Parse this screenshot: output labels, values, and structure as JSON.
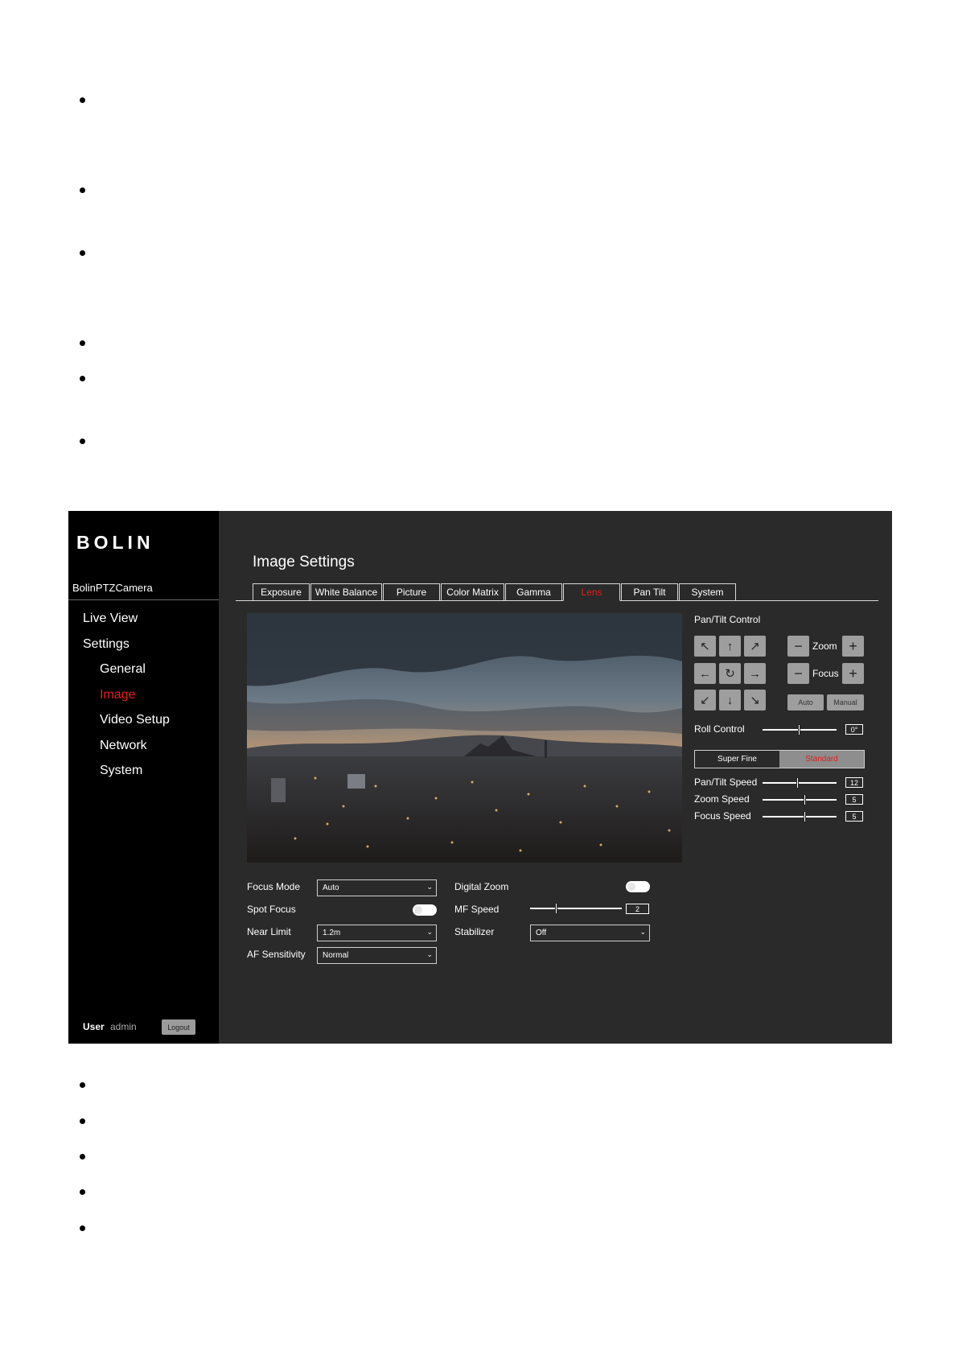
{
  "sidebar": {
    "logo": "BOLIN",
    "device_name": "BolinPTZCamera",
    "nav": [
      {
        "label": "Live View",
        "active": false
      },
      {
        "label": "Settings",
        "active": false
      },
      {
        "label": "General",
        "active": false
      },
      {
        "label": "Image",
        "active": true
      },
      {
        "label": "Video Setup",
        "active": false
      },
      {
        "label": "Network",
        "active": false
      },
      {
        "label": "System",
        "active": false
      }
    ],
    "user_label": "User",
    "user_name": "admin",
    "logout_label": "Logout"
  },
  "page_title": "Image Settings",
  "tabs": [
    {
      "label": "Exposure",
      "active": false
    },
    {
      "label": "White Balance",
      "active": false
    },
    {
      "label": "Picture",
      "active": false
    },
    {
      "label": "Color Matrix",
      "active": false
    },
    {
      "label": "Gamma",
      "active": false
    },
    {
      "label": "Lens",
      "active": true
    },
    {
      "label": "Pan Tilt",
      "active": false
    },
    {
      "label": "System",
      "active": false
    }
  ],
  "lens": {
    "focus_mode_label": "Focus Mode",
    "focus_mode_value": "Auto",
    "spot_focus_label": "Spot Focus",
    "near_limit_label": "Near Limit",
    "near_limit_value": "1.2m",
    "af_sensitivity_label": "AF Sensitivity",
    "af_sensitivity_value": "Normal",
    "digital_zoom_label": "Digital Zoom",
    "mf_speed_label": "MF Speed",
    "mf_speed_value": "2",
    "stabilizer_label": "Stabilizer",
    "stabilizer_value": "Off"
  },
  "ptz": {
    "title": "Pan/Tilt Control",
    "zoom_label": "Zoom",
    "focus_label": "Focus",
    "auto_label": "Auto",
    "manual_label": "Manual",
    "roll_label": "Roll Control",
    "roll_value": "0°",
    "mode_options": [
      "Super Fine",
      "Standard"
    ],
    "mode_selected": "Standard",
    "pan_tilt_speed_label": "Pan/Tilt Speed",
    "pan_tilt_speed_value": "12",
    "zoom_speed_label": "Zoom Speed",
    "zoom_speed_value": "5",
    "focus_speed_label": "Focus Speed",
    "focus_speed_value": "5"
  },
  "colors": {
    "accent": "#e0201b",
    "panel": "#2a2a2a",
    "sidebar": "#000000",
    "button": "#9e9e9e"
  }
}
